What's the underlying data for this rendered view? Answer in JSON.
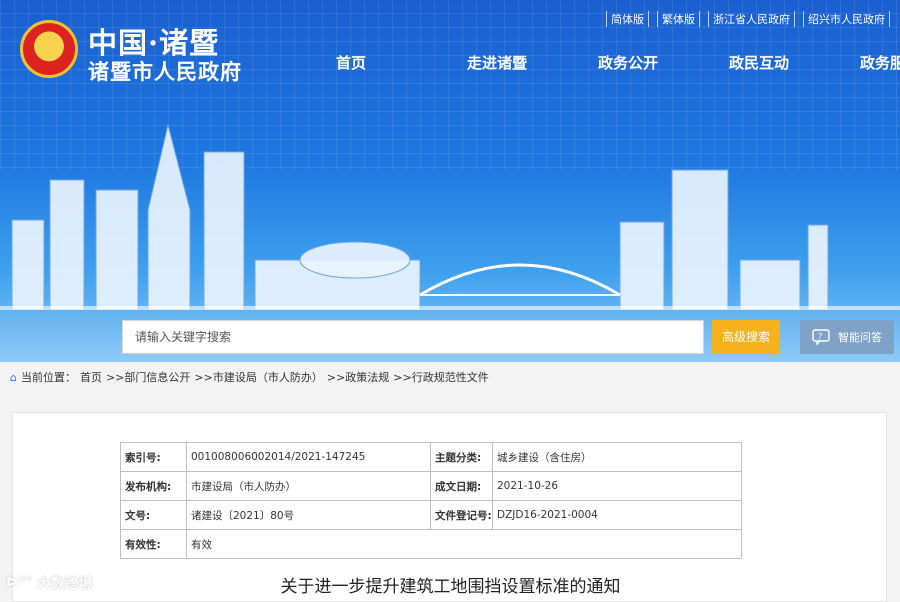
{
  "header": {
    "title_line1": "中国·诸暨",
    "title_line2": "诸暨市人民政府",
    "top_links": [
      "简体版",
      "繁体版",
      "浙江省人民政府",
      "绍兴市人民政府"
    ]
  },
  "nav": [
    "首页",
    "走进诸暨",
    "政务公开",
    "政民互动",
    "政务服务"
  ],
  "search": {
    "placeholder": "请输入关键字搜索",
    "advanced_label": "高级搜索",
    "qa_label": "智能问答"
  },
  "breadcrumb": {
    "prefix": "当前位置：",
    "items": [
      "首页",
      ">>部门信息公开",
      ">>市建设局（市人防办）",
      ">>政策法规",
      ">>行政规范性文件"
    ]
  },
  "meta": {
    "rows": [
      {
        "k1": "索引号:",
        "v1": "001008006002014/2021-147245",
        "k2": "主题分类:",
        "v2": "城乡建设（含住房）"
      },
      {
        "k1": "发布机构:",
        "v1": "市建设局（市人防办）",
        "k2": "成文日期:",
        "v2": "2021-10-26"
      },
      {
        "k1": "文号:",
        "v1": "诸建设〔2021〕80号",
        "k2": "文件登记号:",
        "v2": "DZJD16-2021-0004"
      },
      {
        "k1": "有效性:",
        "v1": "有效",
        "k2": "",
        "v2": ""
      }
    ]
  },
  "document_title": "关于进一步提升建筑工地围挡设置标准的通知",
  "watermark": "大数跨境",
  "colors": {
    "banner": "#1e78e0",
    "advanced_button": "#f6b21a",
    "qa_button": "#7fa2c9"
  }
}
